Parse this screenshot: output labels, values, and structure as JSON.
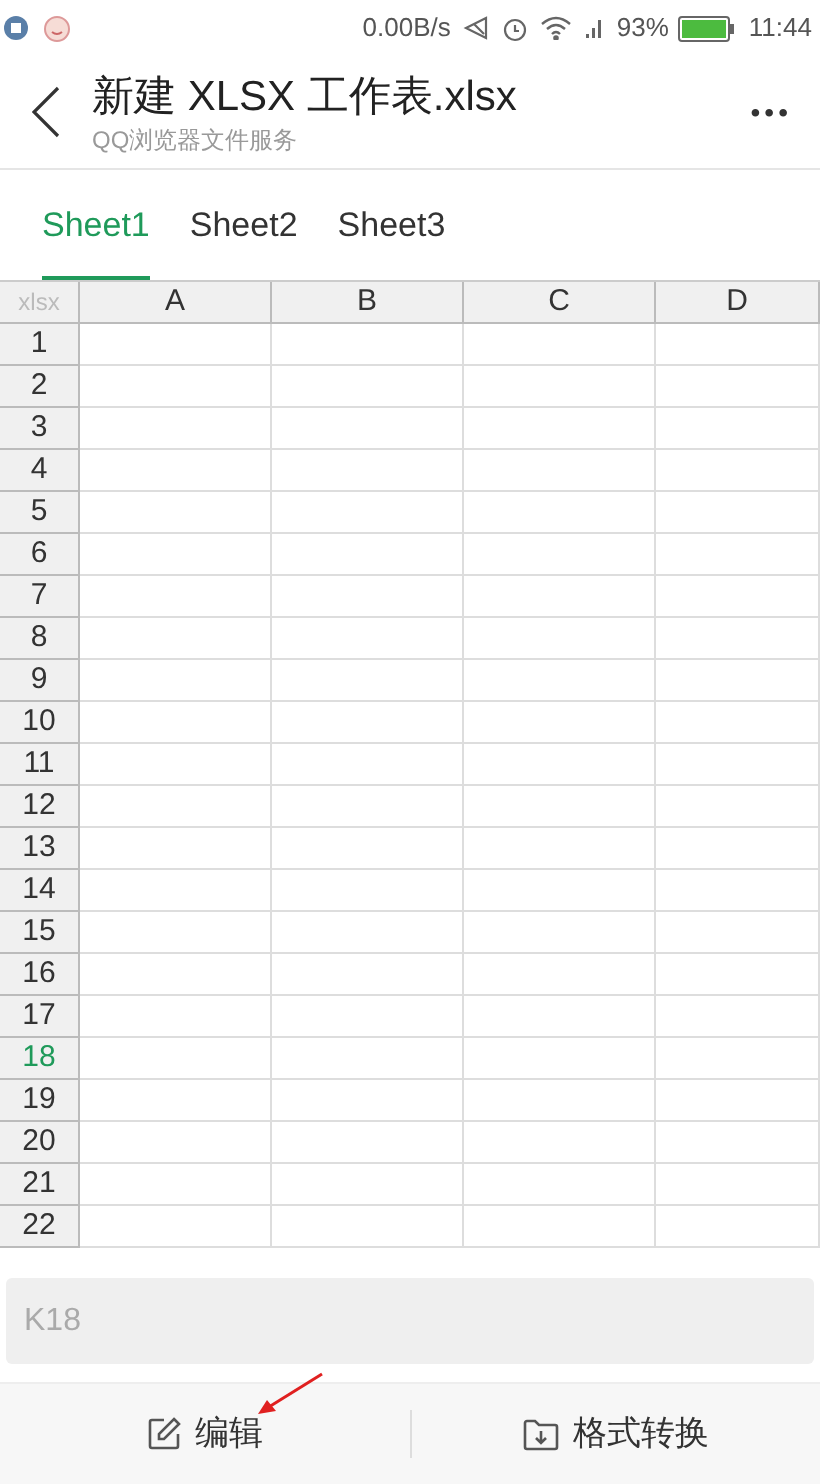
{
  "status_bar": {
    "speed": "0.00B/s",
    "battery": "93%",
    "time": "11:44"
  },
  "header": {
    "title": "新建 XLSX 工作表.xlsx",
    "subtitle": "QQ浏览器文件服务",
    "more": "•••"
  },
  "tabs": [
    {
      "label": "Sheet1",
      "selected": true
    },
    {
      "label": "Sheet2",
      "selected": false
    },
    {
      "label": "Sheet3",
      "selected": false
    }
  ],
  "sheet": {
    "corner": "xlsx",
    "columns": [
      "A",
      "B",
      "C",
      "D"
    ],
    "rows": [
      {
        "label": "1",
        "selected": false
      },
      {
        "label": "2",
        "selected": false
      },
      {
        "label": "3",
        "selected": false
      },
      {
        "label": "4",
        "selected": false
      },
      {
        "label": "5",
        "selected": false
      },
      {
        "label": "6",
        "selected": false
      },
      {
        "label": "7",
        "selected": false
      },
      {
        "label": "8",
        "selected": false
      },
      {
        "label": "9",
        "selected": false
      },
      {
        "label": "10",
        "selected": false
      },
      {
        "label": "11",
        "selected": false
      },
      {
        "label": "12",
        "selected": false
      },
      {
        "label": "13",
        "selected": false
      },
      {
        "label": "14",
        "selected": false
      },
      {
        "label": "15",
        "selected": false
      },
      {
        "label": "16",
        "selected": false
      },
      {
        "label": "17",
        "selected": false
      },
      {
        "label": "18",
        "selected": true
      },
      {
        "label": "19",
        "selected": false
      },
      {
        "label": "20",
        "selected": false
      },
      {
        "label": "21",
        "selected": false
      },
      {
        "label": "22",
        "selected": false
      }
    ]
  },
  "formula_bar": {
    "placeholder": "K18"
  },
  "bottom_bar": [
    {
      "kind": "edit",
      "label": "编辑"
    },
    {
      "kind": "convert",
      "label": "格式转换"
    }
  ]
}
